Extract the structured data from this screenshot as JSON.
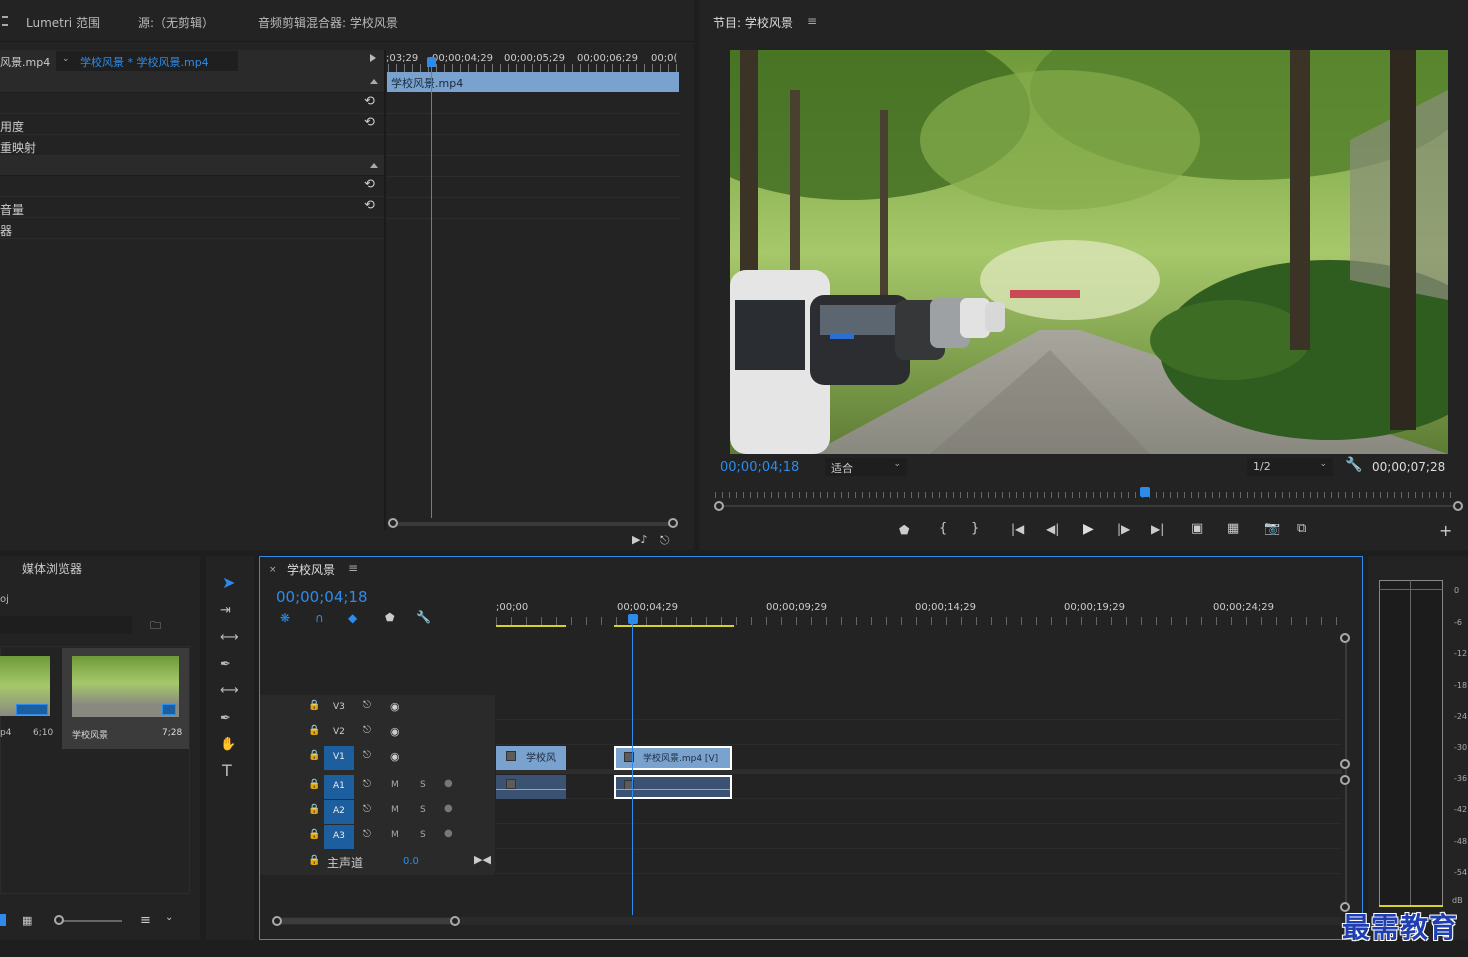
{
  "effect_controls": {
    "tabs": [
      "Lumetri 范围",
      "源:（无剪辑）",
      "音频剪辑混合器: 学校风景"
    ],
    "clip_left": "风景.mp4",
    "clip_selected": "学校风景 * 学校风景.mp4",
    "ruler_times": [
      ";03;29",
      "00;00;04;29",
      "00;00;05;29",
      "00;00;06;29",
      "00;0("
    ],
    "clip_bar": "学校风景.mp4",
    "props": [
      "",
      "",
      "用度",
      "重映射",
      "",
      "",
      "音量",
      "器"
    ]
  },
  "program_monitor": {
    "title": "节目: 学校风景",
    "timecode": "00;00;04;18",
    "fit": "适合",
    "resolution": "1/2",
    "duration": "00;00;07;28",
    "playhead_fraction": 0.58
  },
  "project": {
    "tab": "媒体浏览器",
    "partial": "oj",
    "items": [
      {
        "name": "p4",
        "duration": "6;10"
      },
      {
        "name": "学校风景",
        "duration": "7;28"
      }
    ]
  },
  "timeline": {
    "title": "学校风景",
    "timecode": "00;00;04;18",
    "ruler": [
      ";00;00",
      "00;00;04;29",
      "00;00;09;29",
      "00;00;14;29",
      "00;00;19;29",
      "00;00;24;29"
    ],
    "video_tracks": [
      "V3",
      "V2",
      "V1"
    ],
    "audio_tracks": [
      "A1",
      "A2",
      "A3"
    ],
    "master": "主声道",
    "master_value": "0.0",
    "clip1": "学校风",
    "clip2": "学校风景.mp4 [V]",
    "m": "M",
    "s": "S"
  },
  "meter": {
    "scale": [
      "0",
      "-6",
      "-12",
      "-18",
      "-24",
      "-30",
      "-36",
      "-42",
      "-48",
      "-54",
      "dB"
    ]
  },
  "watermark": "最需教育",
  "colors": {
    "accent": "#2d8ceb",
    "clip": "#7aa2cf",
    "audio_clip": "#3c5273"
  }
}
